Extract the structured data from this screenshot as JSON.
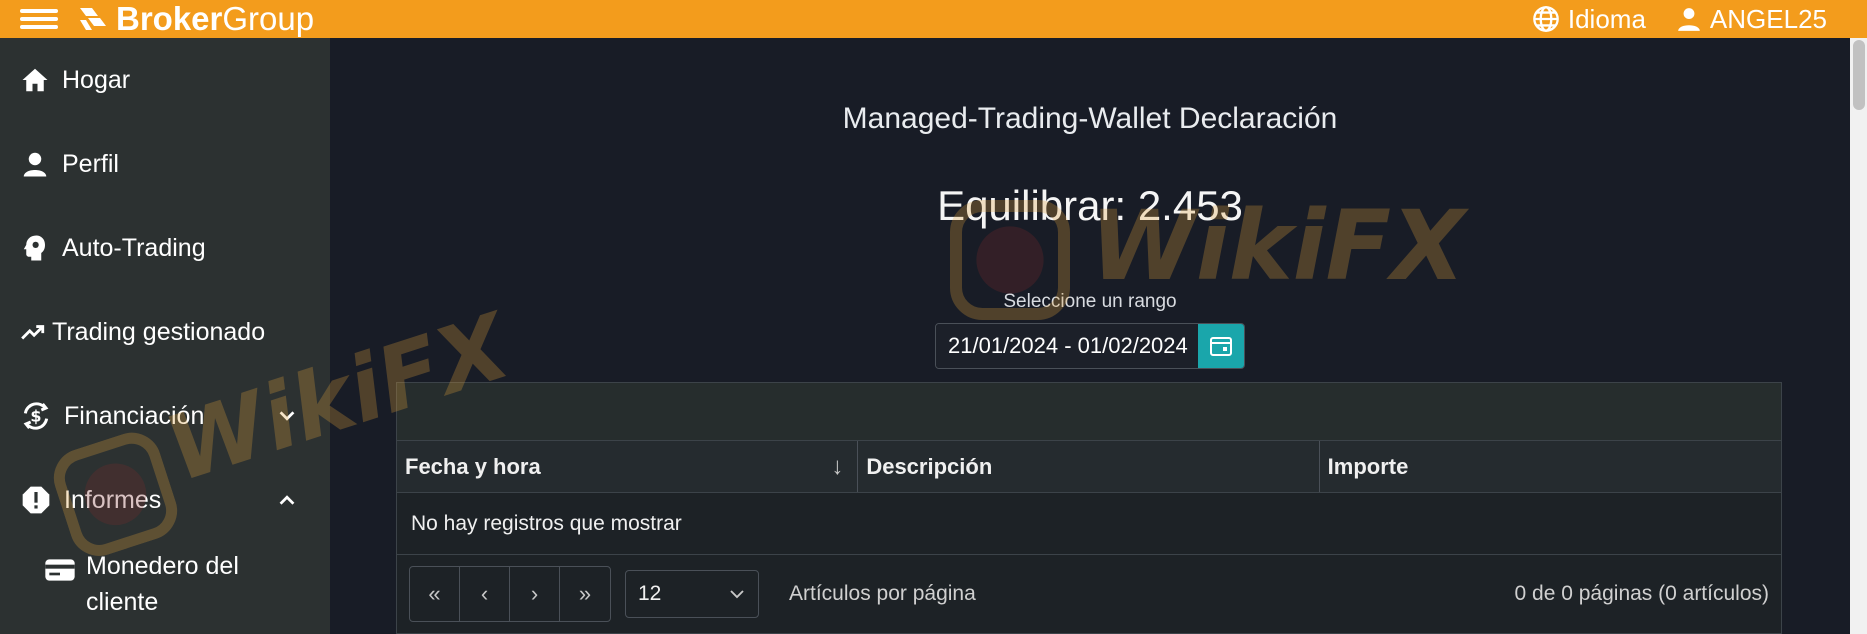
{
  "topbar": {
    "brand_bold": "Broker",
    "brand_light": "Group",
    "language_label": "Idioma",
    "user_label": "ANGEL25"
  },
  "sidebar": {
    "items": [
      {
        "label": "Hogar",
        "icon": "home-icon"
      },
      {
        "label": "Perfil",
        "icon": "person-icon"
      },
      {
        "label": "Auto-Trading",
        "icon": "brain-icon"
      },
      {
        "label": "Trading gestionado",
        "icon": "trending-up-icon"
      },
      {
        "label": "Financiación",
        "icon": "currency-exchange-icon",
        "expanded": false
      },
      {
        "label": "Informes",
        "icon": "alert-icon",
        "expanded": true
      }
    ],
    "sub_items": [
      {
        "label": "Monedero del cliente",
        "icon": "wallet-icon"
      }
    ]
  },
  "main": {
    "title": "Managed-Trading-Wallet Declaración",
    "balance": "Equilibrar: 2.453",
    "range_label": "Seleccione un rango",
    "range_value": "21/01/2024 - 01/02/2024"
  },
  "grid": {
    "columns": [
      "Fecha y hora",
      "Descripción",
      "Importe"
    ],
    "sort_indicator": "↓",
    "empty_message": "No hay registros que mostrar",
    "pager": {
      "first": "«",
      "prev": "‹",
      "next": "›",
      "last": "»",
      "page_size": "12",
      "per_page_label": "Artículos por página",
      "info": "0 de 0 páginas (0 artículos)"
    }
  },
  "watermark": {
    "text": "WikiFX"
  },
  "colors": {
    "topbar": "#f39c1c",
    "sidebar": "#2c3131",
    "background": "#181c26",
    "accent_button": "#1aa6ab"
  }
}
